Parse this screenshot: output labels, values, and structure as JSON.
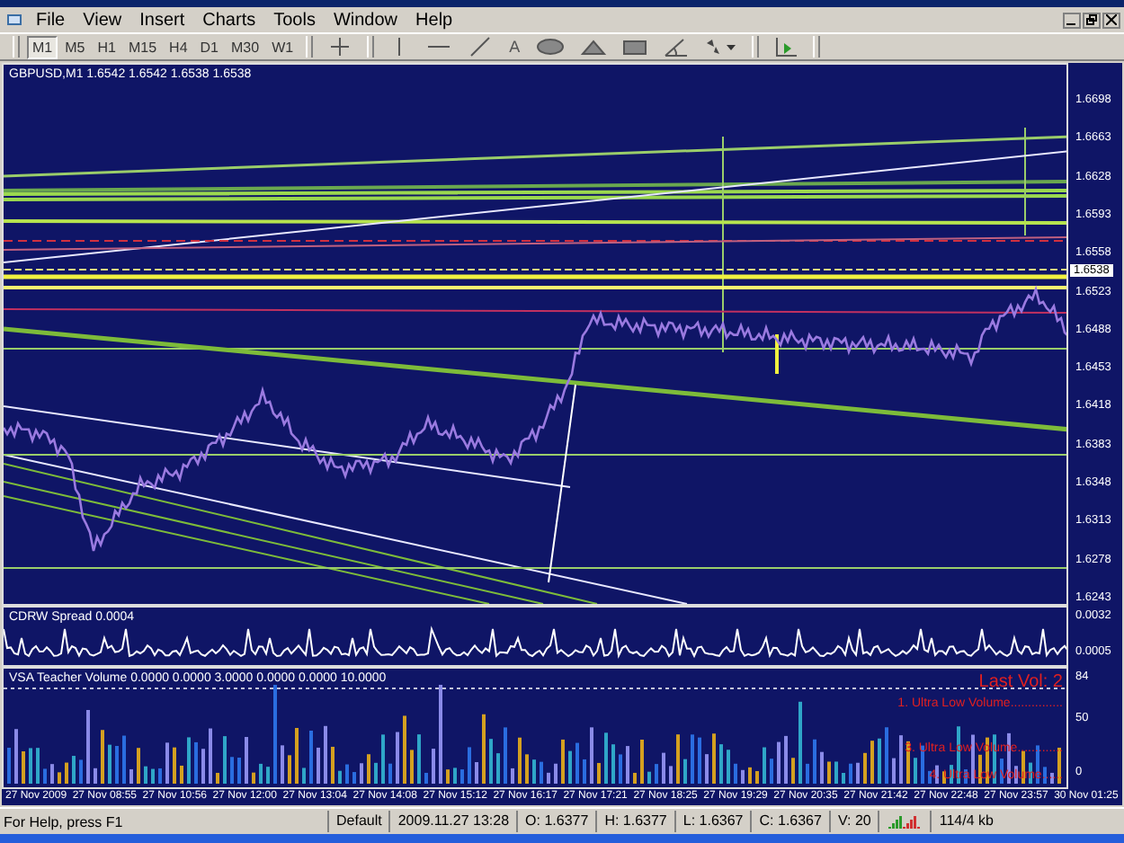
{
  "menu": [
    "File",
    "View",
    "Insert",
    "Charts",
    "Tools",
    "Window",
    "Help"
  ],
  "timeframes": [
    {
      "label": "M1",
      "selected": true
    },
    {
      "label": "M5",
      "selected": false
    },
    {
      "label": "H1",
      "selected": false
    },
    {
      "label": "M15",
      "selected": false
    },
    {
      "label": "H4",
      "selected": false
    },
    {
      "label": "D1",
      "selected": false
    },
    {
      "label": "M30",
      "selected": false
    },
    {
      "label": "W1",
      "selected": false
    }
  ],
  "text_tool": "A",
  "chart": {
    "title": "GBPUSD,M1 1.6542 1.6542 1.6538 1.6538",
    "price_labels": [
      "1.6698",
      "1.6663",
      "1.6628",
      "1.6593",
      "1.6558",
      "1.6523",
      "1.6488",
      "1.6453",
      "1.6418",
      "1.6383",
      "1.6348",
      "1.6313",
      "1.6278",
      "1.6243"
    ],
    "current_price": "1.6538"
  },
  "spread_pane": {
    "label": "CDRW Spread 0.0004",
    "scale": [
      "0.0032",
      "0.0005"
    ]
  },
  "volume_pane": {
    "label": "VSA Teacher Volume 0.0000 0.0000 3.0000 0.0000 0.0000 10.0000",
    "last_vol": "Last Vol: 2",
    "notes": [
      "1. Ultra Low Volume...............",
      "3. Ultra Low Volume.............",
      "4. Ultra Low Volume......"
    ],
    "scale": [
      "84",
      "50",
      "0"
    ]
  },
  "time_axis": [
    "27 Nov 2009",
    "27 Nov 08:55",
    "27 Nov 10:56",
    "27 Nov 12:00",
    "27 Nov 13:04",
    "27 Nov 14:08",
    "27 Nov 15:12",
    "27 Nov 16:17",
    "27 Nov 17:21",
    "27 Nov 18:25",
    "27 Nov 19:29",
    "27 Nov 20:35",
    "27 Nov 21:42",
    "27 Nov 22:48",
    "27 Nov 23:57",
    "30 Nov 01:25"
  ],
  "status_bar": {
    "help": "For Help, press F1",
    "fields": [
      "Default",
      "2009.11.27 13:28",
      "O: 1.6377",
      "H: 1.6377",
      "L: 1.6367",
      "C: 1.6367",
      "V: 20"
    ],
    "traffic": "114/4 kb"
  }
}
